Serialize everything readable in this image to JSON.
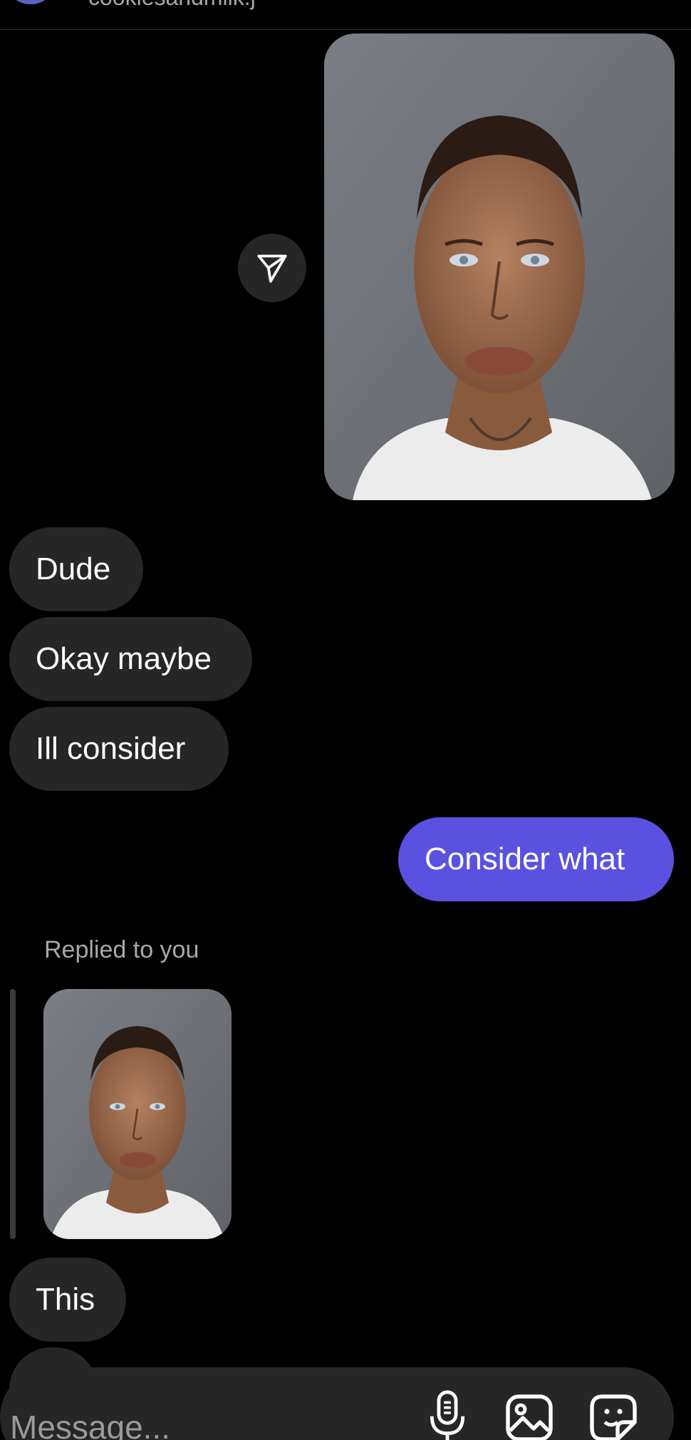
{
  "header": {
    "username": "cookiesandmilk.j"
  },
  "messages": [
    {
      "type": "photo",
      "direction": "outgoing",
      "icon": "mugshot-photo"
    },
    {
      "type": "text",
      "direction": "incoming",
      "text": "Dude"
    },
    {
      "type": "text",
      "direction": "incoming",
      "text": "Okay maybe"
    },
    {
      "type": "text",
      "direction": "incoming",
      "text": "Ill consider"
    },
    {
      "type": "text",
      "direction": "outgoing",
      "text": "Consider what"
    },
    {
      "type": "reply",
      "direction": "incoming",
      "label": "Replied to you",
      "icon": "mugshot-photo"
    },
    {
      "type": "text",
      "direction": "incoming",
      "text": "This"
    },
    {
      "type": "text",
      "direction": "incoming",
      "text": ""
    }
  ],
  "composer": {
    "placeholder": "Message...",
    "icons": [
      "microphone-icon",
      "gallery-icon",
      "sticker-icon"
    ]
  },
  "colors": {
    "background": "#000000",
    "incoming_bubble": "#262626",
    "outgoing_bubble": "#5b51e0",
    "secondary_text": "#a8a8a8"
  }
}
